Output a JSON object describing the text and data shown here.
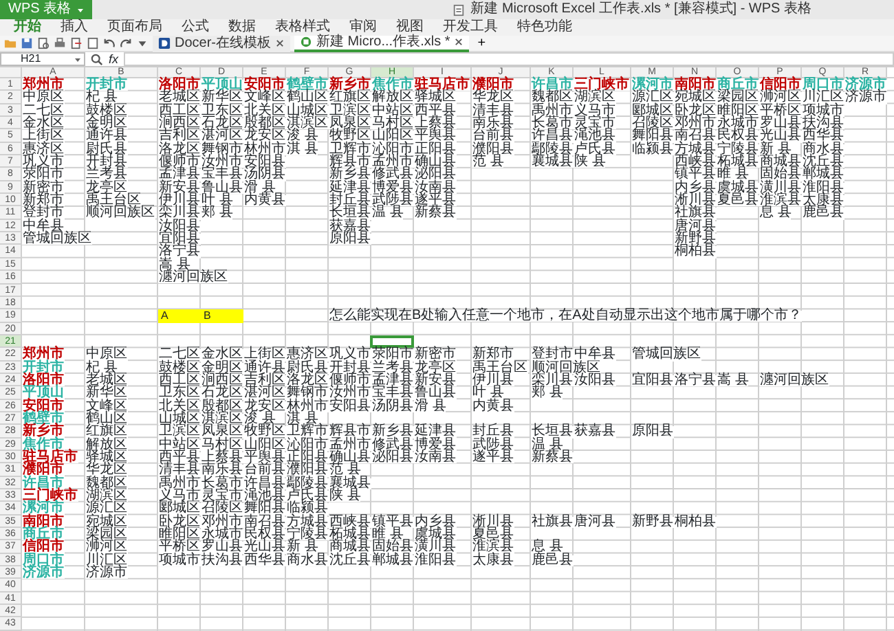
{
  "window": {
    "app_label": "WPS 表格",
    "title": "新建 Microsoft Excel 工作表.xls * [兼容模式] - WPS 表格"
  },
  "menu": [
    {
      "label": "开始",
      "selected": true
    },
    {
      "label": "插入",
      "selected": false
    },
    {
      "label": "页面布局",
      "selected": false
    },
    {
      "label": "公式",
      "selected": false
    },
    {
      "label": "数据",
      "selected": false
    },
    {
      "label": "表格样式",
      "selected": false
    },
    {
      "label": "审阅",
      "selected": false
    },
    {
      "label": "视图",
      "selected": false
    },
    {
      "label": "开发工具",
      "selected": false
    },
    {
      "label": "特色功能",
      "selected": false
    }
  ],
  "doc_tabs": [
    {
      "label": "Docer-在线模板",
      "selected": false
    },
    {
      "label": "新建 Micro...作表.xls *",
      "selected": true
    }
  ],
  "new_tab": "+",
  "formula_bar": {
    "name_box": "H21",
    "fx": "fx"
  },
  "sheet": {
    "columns": [
      {
        "letter": "A",
        "selected": false
      },
      {
        "letter": "B",
        "selected": false
      },
      {
        "letter": "C",
        "selected": false
      },
      {
        "letter": "D",
        "selected": false
      },
      {
        "letter": "E",
        "selected": false
      },
      {
        "letter": "F",
        "selected": false
      },
      {
        "letter": "G",
        "selected": false
      },
      {
        "letter": "H",
        "selected": true
      },
      {
        "letter": "I",
        "selected": false
      },
      {
        "letter": "J",
        "selected": false
      },
      {
        "letter": "K",
        "selected": false
      },
      {
        "letter": "L",
        "selected": false
      },
      {
        "letter": "M",
        "selected": false
      },
      {
        "letter": "N",
        "selected": false
      },
      {
        "letter": "O",
        "selected": false
      },
      {
        "letter": "P",
        "selected": false
      },
      {
        "letter": "Q",
        "selected": false
      },
      {
        "letter": "R",
        "selected": false
      }
    ],
    "rows": [
      {
        "label": "1",
        "selected": false
      },
      {
        "label": "2",
        "selected": false
      },
      {
        "label": "3",
        "selected": false
      },
      {
        "label": "4",
        "selected": false
      },
      {
        "label": "5",
        "selected": false
      },
      {
        "label": "6",
        "selected": false
      },
      {
        "label": "7",
        "selected": false
      },
      {
        "label": "8",
        "selected": false
      },
      {
        "label": "9",
        "selected": false
      },
      {
        "label": "10",
        "selected": false
      },
      {
        "label": "11",
        "selected": false
      },
      {
        "label": "12",
        "selected": false
      },
      {
        "label": "13",
        "selected": false
      },
      {
        "label": "14",
        "selected": false
      },
      {
        "label": "15",
        "selected": false
      },
      {
        "label": "16",
        "selected": false
      },
      {
        "label": "17",
        "selected": false
      },
      {
        "label": "18",
        "selected": false
      },
      {
        "label": "19",
        "selected": false
      },
      {
        "label": "20",
        "selected": false
      },
      {
        "label": "21",
        "selected": true
      },
      {
        "label": "22",
        "selected": false
      },
      {
        "label": "23",
        "selected": false
      },
      {
        "label": "24",
        "selected": false
      },
      {
        "label": "25",
        "selected": false
      },
      {
        "label": "26",
        "selected": false
      },
      {
        "label": "27",
        "selected": false
      },
      {
        "label": "28",
        "selected": false
      },
      {
        "label": "29",
        "selected": false
      },
      {
        "label": "30",
        "selected": false
      },
      {
        "label": "31",
        "selected": false
      },
      {
        "label": "32",
        "selected": false
      },
      {
        "label": "33",
        "selected": false
      },
      {
        "label": "34",
        "selected": false
      },
      {
        "label": "35",
        "selected": false
      },
      {
        "label": "36",
        "selected": false
      },
      {
        "label": "37",
        "selected": false
      },
      {
        "label": "38",
        "selected": false
      },
      {
        "label": "39",
        "selected": false
      },
      {
        "label": "40",
        "selected": false
      },
      {
        "label": "41",
        "selected": false
      },
      {
        "label": "42",
        "selected": false
      },
      {
        "label": "43",
        "selected": false
      }
    ],
    "city_table": [
      {
        "city": "郑州市",
        "color": "#c00000",
        "places": [
          "中原区",
          "二七区",
          "金水区",
          "上街区",
          "惠济区",
          "巩义市",
          "荥阳市",
          "新密市",
          "新郑市",
          "登封市",
          "中牟县",
          "管城回族区"
        ]
      },
      {
        "city": "开封市",
        "color": "#2bb3a3",
        "places": [
          "杞 县",
          "鼓楼区",
          "金明区",
          "通许县",
          "尉氏县",
          "开封县",
          "兰考县",
          "龙亭区",
          "禹王台区",
          "顺河回族区"
        ]
      },
      {
        "city": "洛阳市",
        "color": "#c00000",
        "places": [
          "老城区",
          "西工区",
          "涧西区",
          "吉利区",
          "洛龙区",
          "偃师市",
          "孟津县",
          "新安县",
          "伊川县",
          "栾川县",
          "汝阳县",
          "宜阳县",
          "洛宁县",
          "嵩 县",
          "瀍河回族区"
        ]
      },
      {
        "city": "平顶山",
        "color": "#2bb3a3",
        "places": [
          "新华区",
          "卫东区",
          "石龙区",
          "湛河区",
          "舞钢市",
          "汝州市",
          "宝丰县",
          "鲁山县",
          "叶 县",
          "郏 县"
        ]
      },
      {
        "city": "安阳市",
        "color": "#c00000",
        "places": [
          "文峰区",
          "北关区",
          "殷都区",
          "龙安区",
          "林州市",
          "安阳县",
          "汤阴县",
          "滑 县",
          "内黄县"
        ]
      },
      {
        "city": "鹤壁市",
        "color": "#2bb3a3",
        "places": [
          "鹤山区",
          "山城区",
          "淇滨区",
          "浚 县",
          "淇 县"
        ]
      },
      {
        "city": "新乡市",
        "color": "#c00000",
        "places": [
          "红旗区",
          "卫滨区",
          "凤泉区",
          "牧野区",
          "卫辉市",
          "辉县市",
          "新乡县",
          "延津县",
          "封丘县",
          "长垣县",
          "获嘉县",
          "原阳县"
        ]
      },
      {
        "city": "焦作市",
        "color": "#2bb3a3",
        "places": [
          "解放区",
          "中站区",
          "马村区",
          "山阳区",
          "沁阳市",
          "孟州市",
          "修武县",
          "博爱县",
          "武陟县",
          "温 县"
        ]
      },
      {
        "city": "驻马店市",
        "color": "#c00000",
        "places": [
          "驿城区",
          "西平县",
          "上蔡县",
          "平舆县",
          "正阳县",
          "确山县",
          "泌阳县",
          "汝南县",
          "遂平县",
          "新蔡县"
        ]
      },
      {
        "city": "濮阳市",
        "color": "#c00000",
        "places": [
          "华龙区",
          "清丰县",
          "南乐县",
          "台前县",
          "濮阳县",
          "范 县"
        ]
      },
      {
        "city": "许昌市",
        "color": "#2bb3a3",
        "places": [
          "魏都区",
          "禹州市",
          "长葛市",
          "许昌县",
          "鄢陵县",
          "襄城县"
        ]
      },
      {
        "city": "三门峡市",
        "color": "#c00000",
        "places": [
          "湖滨区",
          "义马市",
          "灵宝市",
          "渑池县",
          "卢氏县",
          "陕 县"
        ]
      },
      {
        "city": "漯河市",
        "color": "#2bb3a3",
        "places": [
          "源汇区",
          "郾城区",
          "召陵区",
          "舞阳县",
          "临颍县"
        ]
      },
      {
        "city": "南阳市",
        "color": "#c00000",
        "places": [
          "宛城区",
          "卧龙区",
          "邓州市",
          "南召县",
          "方城县",
          "西峡县",
          "镇平县",
          "内乡县",
          "淅川县",
          "社旗县",
          "唐河县",
          "新野县",
          "桐柏县"
        ]
      },
      {
        "city": "商丘市",
        "color": "#2bb3a3",
        "places": [
          "梁园区",
          "睢阳区",
          "永城市",
          "民权县",
          "宁陵县",
          "柘城县",
          "睢 县",
          "虞城县",
          "夏邑县"
        ]
      },
      {
        "city": "信阳市",
        "color": "#c00000",
        "places": [
          "浉河区",
          "平桥区",
          "罗山县",
          "光山县",
          "新 县",
          "商城县",
          "固始县",
          "潢川县",
          "淮滨县",
          "息 县"
        ]
      },
      {
        "city": "周口市",
        "color": "#2bb3a3",
        "places": [
          "川汇区",
          "项城市",
          "扶沟县",
          "西华县",
          "商水县",
          "沈丘县",
          "郸城县",
          "淮阳县",
          "太康县",
          "鹿邑县"
        ]
      },
      {
        "city": "济源市",
        "color": "#2bb3a3",
        "places": [
          "济源市"
        ]
      }
    ],
    "note": [
      {
        "text": "A",
        "highlighted": true
      },
      {
        "text": "B",
        "highlighted": true
      },
      {
        "text": "怎么能实现在B处输入任意一个地市，在A处自动显示出这个地市属于哪个市？",
        "highlighted": false
      }
    ],
    "lookup_table": [
      {
        "city": "郑州市",
        "color": "#c00000",
        "places": [
          "中原区",
          "二七区",
          "金水区",
          "上街区",
          "惠济区",
          "巩义市",
          "荥阳市",
          "新密市",
          "新郑市",
          "登封市",
          "中牟县",
          "管城回族区"
        ]
      },
      {
        "city": "开封市",
        "color": "#2bb3a3",
        "places": [
          "杞 县",
          "鼓楼区",
          "金明区",
          "通许县",
          "尉氏县",
          "开封县",
          "兰考县",
          "龙亭区",
          "禹王台区",
          "顺河回族区"
        ]
      },
      {
        "city": "洛阳市",
        "color": "#c00000",
        "places": [
          "老城区",
          "西工区",
          "涧西区",
          "吉利区",
          "洛龙区",
          "偃师市",
          "孟津县",
          "新安县",
          "伊川县",
          "栾川县",
          "汝阳县",
          "宜阳县",
          "洛宁县",
          "嵩 县",
          "瀍河回族区"
        ]
      },
      {
        "city": "平顶山",
        "color": "#2bb3a3",
        "places": [
          "新华区",
          "卫东区",
          "石龙区",
          "湛河区",
          "舞钢市",
          "汝州市",
          "宝丰县",
          "鲁山县",
          "叶 县",
          "郏 县"
        ]
      },
      {
        "city": "安阳市",
        "color": "#c00000",
        "places": [
          "文峰区",
          "北关区",
          "殷都区",
          "龙安区",
          "林州市",
          "安阳县",
          "汤阴县",
          "滑 县",
          "内黄县"
        ]
      },
      {
        "city": "鹤壁市",
        "color": "#2bb3a3",
        "places": [
          "鹤山区",
          "山城区",
          "淇滨区",
          "浚 县",
          "淇 县"
        ]
      },
      {
        "city": "新乡市",
        "color": "#c00000",
        "places": [
          "红旗区",
          "卫滨区",
          "凤泉区",
          "牧野区",
          "卫辉市",
          "辉县市",
          "新乡县",
          "延津县",
          "封丘县",
          "长垣县",
          "获嘉县",
          "原阳县"
        ]
      },
      {
        "city": "焦作市",
        "color": "#2bb3a3",
        "places": [
          "解放区",
          "中站区",
          "马村区",
          "山阳区",
          "沁阳市",
          "孟州市",
          "修武县",
          "博爱县",
          "武陟县",
          "温 县"
        ]
      },
      {
        "city": "驻马店市",
        "color": "#c00000",
        "places": [
          "驿城区",
          "西平县",
          "上蔡县",
          "平舆县",
          "正阳县",
          "确山县",
          "泌阳县",
          "汝南县",
          "遂平县",
          "新蔡县"
        ]
      },
      {
        "city": "濮阳市",
        "color": "#c00000",
        "places": [
          "华龙区",
          "清丰县",
          "南乐县",
          "台前县",
          "濮阳县",
          "范 县"
        ]
      },
      {
        "city": "许昌市",
        "color": "#2bb3a3",
        "places": [
          "魏都区",
          "禹州市",
          "长葛市",
          "许昌县",
          "鄢陵县",
          "襄城县"
        ]
      },
      {
        "city": "三门峡市",
        "color": "#c00000",
        "places": [
          "湖滨区",
          "义马市",
          "灵宝市",
          "渑池县",
          "卢氏县",
          "陕 县"
        ]
      },
      {
        "city": "漯河市",
        "color": "#2bb3a3",
        "places": [
          "源汇区",
          "郾城区",
          "召陵区",
          "舞阳县",
          "临颍县"
        ]
      },
      {
        "city": "南阳市",
        "color": "#c00000",
        "places": [
          "宛城区",
          "卧龙区",
          "邓州市",
          "南召县",
          "方城县",
          "西峡县",
          "镇平县",
          "内乡县",
          "淅川县",
          "社旗县",
          "唐河县",
          "新野县",
          "桐柏县"
        ]
      },
      {
        "city": "商丘市",
        "color": "#2bb3a3",
        "places": [
          "梁园区",
          "睢阳区",
          "永城市",
          "民权县",
          "宁陵县",
          "柘城县",
          "睢 县",
          "虞城县",
          "夏邑县"
        ]
      },
      {
        "city": "信阳市",
        "color": "#c00000",
        "places": [
          "浉河区",
          "平桥区",
          "罗山县",
          "光山县",
          "新 县",
          "商城县",
          "固始县",
          "潢川县",
          "淮滨县",
          "息 县"
        ]
      },
      {
        "city": "周口市",
        "color": "#2bb3a3",
        "places": [
          "川汇区",
          "项城市",
          "扶沟县",
          "西华县",
          "商水县",
          "沈丘县",
          "郸城县",
          "淮阳县",
          "太康县",
          "鹿邑县"
        ]
      },
      {
        "city": "济源市",
        "color": "#2bb3a3",
        "places": [
          "济源市"
        ]
      }
    ]
  }
}
